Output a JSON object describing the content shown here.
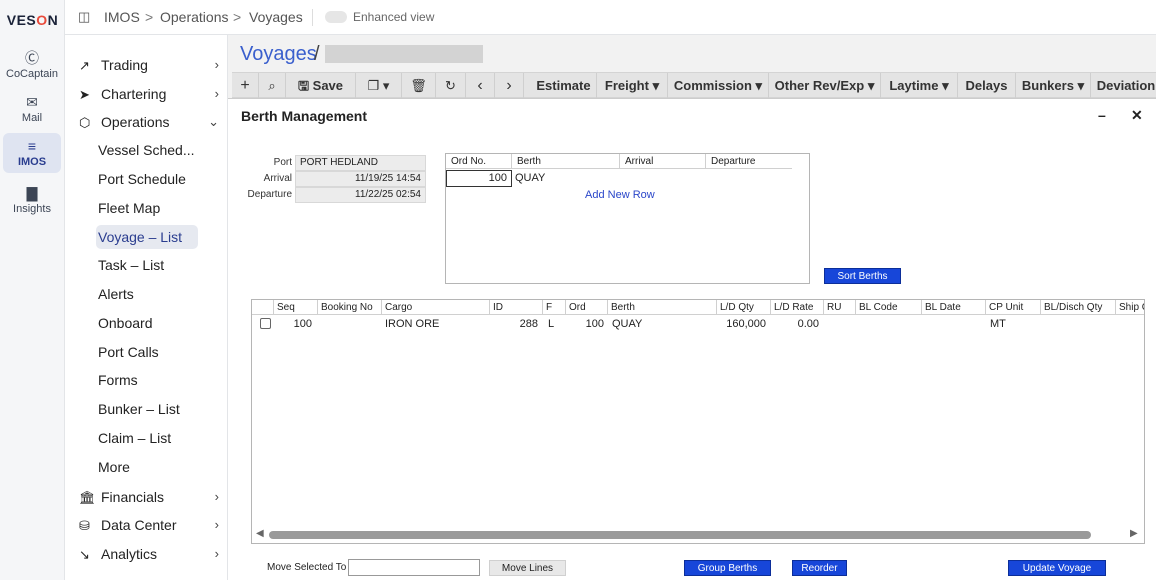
{
  "rail": {
    "logo_a": "VES",
    "logo_o": "O",
    "logo_b": "N",
    "items": [
      {
        "label": "CoCaptain",
        "icon": "cocaptain-icon"
      },
      {
        "label": "Mail",
        "icon": "mail-icon"
      },
      {
        "label": "IMOS",
        "icon": "imos-icon"
      },
      {
        "label": "Insights",
        "icon": "insights-icon"
      }
    ]
  },
  "header": {
    "crumbs": [
      "IMOS",
      "Operations",
      "Voyages"
    ],
    "enhanced_view": "Enhanced view"
  },
  "sidebar": {
    "trading": "Trading",
    "chartering": "Chartering",
    "operations": "Operations",
    "sub": [
      "Vessel Sched...",
      "Port Schedule",
      "Fleet Map",
      "Voyage  – List",
      "Task  – List",
      "Alerts",
      "Onboard",
      "Port Calls",
      "Forms",
      "Bunker  – List",
      "Claim  – List",
      "More"
    ],
    "financials": "Financials",
    "data_center": "Data Center",
    "analytics": "Analytics"
  },
  "page": {
    "title": "Voyages",
    "slash": "/"
  },
  "toolbar": {
    "save": "Save",
    "menus": [
      "Estimate",
      "Freight",
      "Commission",
      "Other Rev/Exp",
      "Laytime",
      "Delays",
      "Bunkers",
      "Deviation"
    ]
  },
  "dialog": {
    "title": "Berth Management",
    "port_label": "Port",
    "port_value": "PORT HEDLAND",
    "arrival_label": "Arrival",
    "arrival_value": "11/19/25 14:54",
    "departure_label": "Departure",
    "departure_value": "11/22/25 02:54",
    "berth_headers": [
      "Ord No.",
      "Berth",
      "Arrival",
      "Departure"
    ],
    "berth_row": {
      "ord": "100",
      "berth": "QUAY"
    },
    "add_new_row": "Add New Row",
    "sort_berths": "Sort Berths",
    "cargo_headers": [
      "Seq",
      "Booking No",
      "Cargo",
      "ID",
      "F",
      "Ord",
      "Berth",
      "L/D Qty",
      "L/D Rate",
      "RU",
      "BL Code",
      "BL Date",
      "CP Unit",
      "BL/Disch Qty",
      "Ship C"
    ],
    "cargo_row": {
      "seq": "100",
      "cargo": "IRON ORE",
      "id": "288",
      "f": "L",
      "ord": "100",
      "berth": "QUAY",
      "ld_qty": "160,000",
      "ld_rate": "0.00",
      "cp_unit": "MT"
    },
    "move_selected_to": "Move Selected To",
    "move_lines": "Move Lines",
    "group_berths": "Group Berths",
    "reorder": "Reorder",
    "update_voyage": "Update Voyage"
  }
}
